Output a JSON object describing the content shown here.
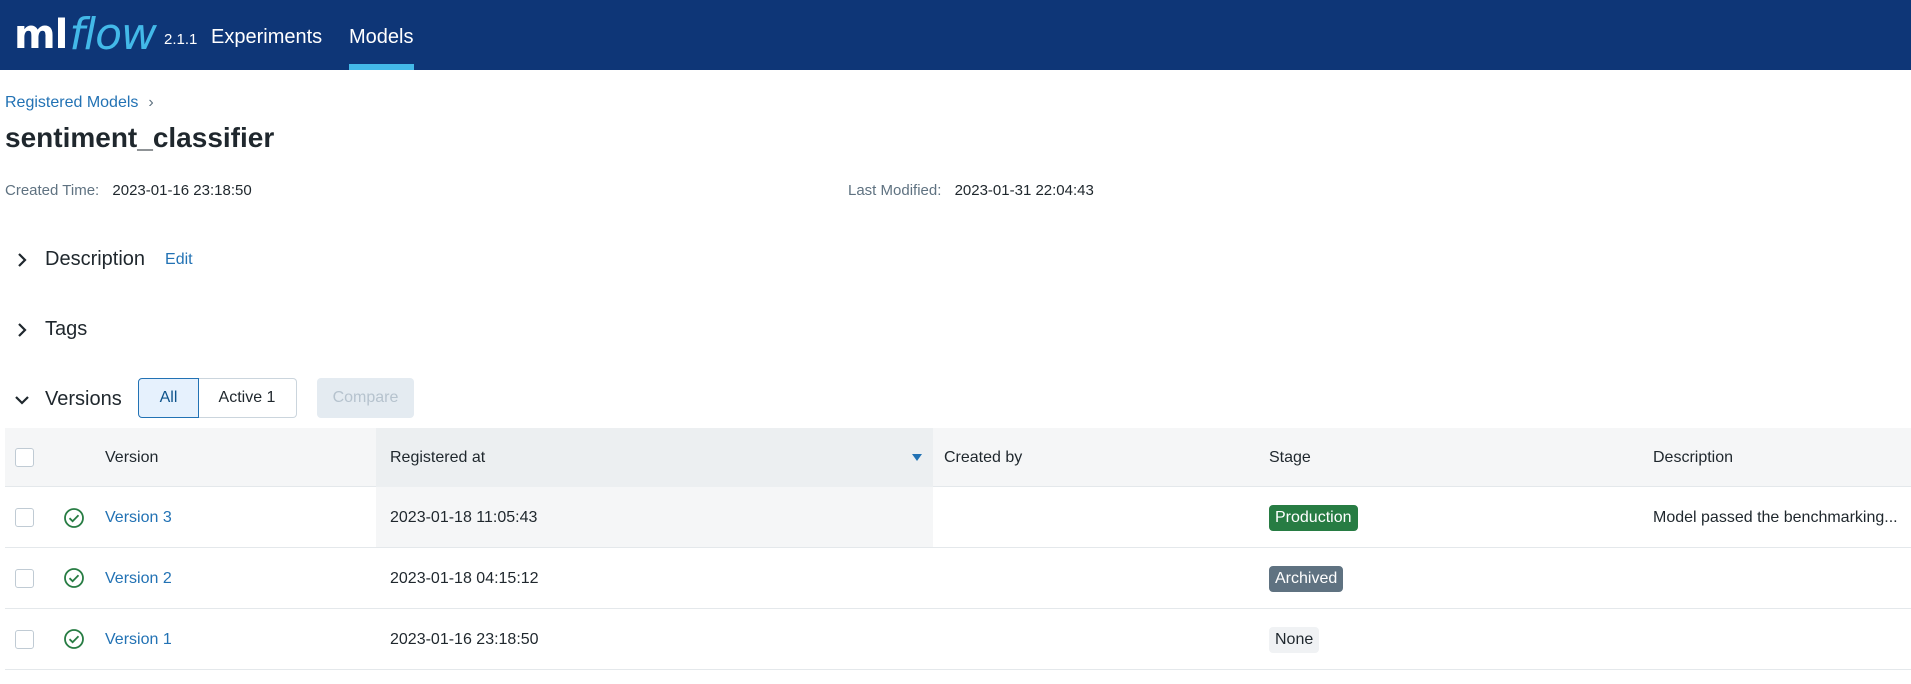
{
  "header": {
    "logo_ml": "ml",
    "logo_flow": "flow",
    "version": "2.1.1",
    "nav": [
      {
        "label": "Experiments"
      },
      {
        "label": "Models"
      }
    ],
    "colors": {
      "bar": "#0e3677",
      "accent": "#43b9e8"
    }
  },
  "breadcrumb": {
    "parent": "Registered Models",
    "separator": "›"
  },
  "page": {
    "title": "sentiment_classifier"
  },
  "meta": {
    "created_label": "Created Time:",
    "created_value": "2023-01-16 23:18:50",
    "modified_label": "Last Modified:",
    "modified_value": "2023-01-31 22:04:43"
  },
  "sections": {
    "description": {
      "title": "Description",
      "edit_label": "Edit",
      "expanded": false
    },
    "tags": {
      "title": "Tags",
      "expanded": false
    },
    "versions": {
      "title": "Versions",
      "expanded": true
    }
  },
  "filters": {
    "all_label": "All",
    "active_label": "Active 1",
    "compare_label": "Compare"
  },
  "table": {
    "columns": {
      "version": "Version",
      "registered_at": "Registered at",
      "created_by": "Created by",
      "stage": "Stage",
      "description": "Description"
    },
    "sorted_column": "registered_at",
    "rows": [
      {
        "version": "Version 3",
        "registered_at": "2023-01-18 11:05:43",
        "created_by": "",
        "stage": "Production",
        "description": "Model passed the benchmarking..."
      },
      {
        "version": "Version 2",
        "registered_at": "2023-01-18 04:15:12",
        "created_by": "",
        "stage": "Archived",
        "description": ""
      },
      {
        "version": "Version 1",
        "registered_at": "2023-01-16 23:18:50",
        "created_by": "",
        "stage": "None",
        "description": ""
      }
    ],
    "stage_colors": {
      "Production": "#277c43",
      "Archived": "#5f7281",
      "None": "#f0f2f4"
    }
  }
}
